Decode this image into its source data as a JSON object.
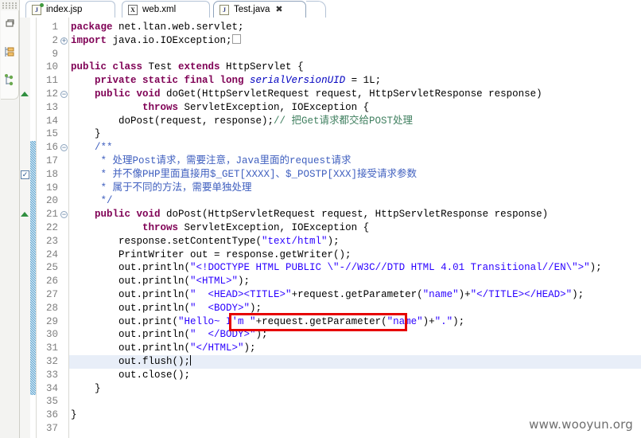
{
  "window": {
    "watermark": "www.wooyun.org"
  },
  "left_rail": {
    "drag_handle": "drag-handle",
    "icons": [
      {
        "name": "restore-view-icon",
        "glyph": "restore"
      },
      {
        "name": "outline-view-icon",
        "glyph": "outline"
      },
      {
        "name": "hierarchy-view-icon",
        "glyph": "hierarchy"
      }
    ]
  },
  "tabs": [
    {
      "label": "index.jsp",
      "icon": "jsp-file-icon",
      "icon_letter": "J",
      "active": false,
      "closable": false
    },
    {
      "label": "web.xml",
      "icon": "xml-file-icon",
      "icon_letter": "X",
      "active": false,
      "closable": false
    },
    {
      "label": "Test.java",
      "icon": "java-file-icon",
      "icon_letter": "J",
      "active": true,
      "closable": true,
      "close_glyph": "✖"
    }
  ],
  "editor": {
    "current_line": 32,
    "change_bar_from": 16,
    "change_bar_to": 34,
    "fold_markers": [
      {
        "line": 2,
        "type": "expand"
      },
      {
        "line": 12,
        "type": "collapse"
      },
      {
        "line": 16,
        "type": "collapse"
      },
      {
        "line": 21,
        "type": "collapse"
      }
    ],
    "overview_triangles": [
      12,
      21
    ],
    "task_checkbox_line": 18,
    "lines": [
      {
        "n": 1,
        "tokens": [
          {
            "t": "kw",
            "v": "package"
          },
          {
            "t": "cn",
            "v": " net.ltan.web.servlet;"
          }
        ]
      },
      {
        "n": 2,
        "tokens": [
          {
            "t": "kw",
            "v": "import"
          },
          {
            "t": "cn",
            "v": " java.io.IOException;"
          },
          {
            "t": "box",
            "v": " "
          }
        ]
      },
      {
        "n": 9,
        "tokens": []
      },
      {
        "n": 10,
        "tokens": [
          {
            "t": "kw",
            "v": "public class"
          },
          {
            "t": "cn",
            "v": " Test "
          },
          {
            "t": "kw",
            "v": "extends"
          },
          {
            "t": "cn",
            "v": " HttpServlet {"
          }
        ]
      },
      {
        "n": 11,
        "tokens": [
          {
            "t": "cn",
            "v": "    "
          },
          {
            "t": "kw",
            "v": "private static final long"
          },
          {
            "t": "fld",
            "v": " serialVersionUID"
          },
          {
            "t": "cn",
            "v": " = 1L;"
          }
        ]
      },
      {
        "n": 12,
        "tokens": [
          {
            "t": "cn",
            "v": "    "
          },
          {
            "t": "kw",
            "v": "public void"
          },
          {
            "t": "cn",
            "v": " doGet(HttpServletRequest request, HttpServletResponse response)"
          }
        ]
      },
      {
        "n": 13,
        "tokens": [
          {
            "t": "cn",
            "v": "            "
          },
          {
            "t": "kw",
            "v": "throws"
          },
          {
            "t": "cn",
            "v": " ServletException, IOException {"
          }
        ]
      },
      {
        "n": 14,
        "tokens": [
          {
            "t": "cn",
            "v": "        doPost(request, response);"
          },
          {
            "t": "cmt",
            "v": "// 把Get请求都交给POST处理"
          }
        ]
      },
      {
        "n": 15,
        "tokens": [
          {
            "t": "cn",
            "v": "    }"
          }
        ]
      },
      {
        "n": 16,
        "tokens": [
          {
            "t": "jdoc",
            "v": "    /**"
          }
        ]
      },
      {
        "n": 17,
        "tokens": [
          {
            "t": "jdoc",
            "v": "     * 处理Post请求，需要注意，Java里面的request请求"
          }
        ]
      },
      {
        "n": 18,
        "tokens": [
          {
            "t": "jdoc",
            "v": "     * 并不像PHP里面直接用$_GET[XXXX]、$_POSTP[XXX]接受请求参数"
          }
        ]
      },
      {
        "n": 19,
        "tokens": [
          {
            "t": "jdoc",
            "v": "     * 属于不同的方法，需要单独处理"
          }
        ]
      },
      {
        "n": 20,
        "tokens": [
          {
            "t": "jdoc",
            "v": "     */"
          }
        ]
      },
      {
        "n": 21,
        "tokens": [
          {
            "t": "cn",
            "v": "    "
          },
          {
            "t": "kw",
            "v": "public void"
          },
          {
            "t": "cn",
            "v": " doPost(HttpServletRequest request, HttpServletResponse response)"
          }
        ]
      },
      {
        "n": 22,
        "tokens": [
          {
            "t": "cn",
            "v": "            "
          },
          {
            "t": "kw",
            "v": "throws"
          },
          {
            "t": "cn",
            "v": " ServletException, IOException {"
          }
        ]
      },
      {
        "n": 23,
        "tokens": [
          {
            "t": "cn",
            "v": "        response.setContentType("
          },
          {
            "t": "str",
            "v": "\"text/html\""
          },
          {
            "t": "cn",
            "v": ");"
          }
        ]
      },
      {
        "n": 24,
        "tokens": [
          {
            "t": "cn",
            "v": "        PrintWriter out = response.getWriter();"
          }
        ]
      },
      {
        "n": 25,
        "tokens": [
          {
            "t": "cn",
            "v": "        out.println("
          },
          {
            "t": "str",
            "v": "\"<!DOCTYPE HTML PUBLIC \\\"-//W3C//DTD HTML 4.01 Transitional//EN\\\">\""
          },
          {
            "t": "cn",
            "v": ");"
          }
        ]
      },
      {
        "n": 26,
        "tokens": [
          {
            "t": "cn",
            "v": "        out.println("
          },
          {
            "t": "str",
            "v": "\"<HTML>\""
          },
          {
            "t": "cn",
            "v": ");"
          }
        ]
      },
      {
        "n": 27,
        "tokens": [
          {
            "t": "cn",
            "v": "        out.println("
          },
          {
            "t": "str",
            "v": "\"  <HEAD><TITLE>\""
          },
          {
            "t": "cn",
            "v": "+request.getParameter("
          },
          {
            "t": "str",
            "v": "\"name\""
          },
          {
            "t": "cn",
            "v": ")+"
          },
          {
            "t": "str",
            "v": "\"</TITLE></HEAD>\""
          },
          {
            "t": "cn",
            "v": ");"
          }
        ]
      },
      {
        "n": 28,
        "tokens": [
          {
            "t": "cn",
            "v": "        out.println("
          },
          {
            "t": "str",
            "v": "\"  <BODY>\""
          },
          {
            "t": "cn",
            "v": ");"
          }
        ]
      },
      {
        "n": 29,
        "tokens": [
          {
            "t": "cn",
            "v": "        out.print("
          },
          {
            "t": "str",
            "v": "\"Hello~ I'm \""
          },
          {
            "t": "cn",
            "v": "+request.getParameter("
          },
          {
            "t": "str",
            "v": "\"name\""
          },
          {
            "t": "cn",
            "v": ")+"
          },
          {
            "t": "str",
            "v": "\".\""
          },
          {
            "t": "cn",
            "v": ");"
          }
        ]
      },
      {
        "n": 30,
        "tokens": [
          {
            "t": "cn",
            "v": "        out.println("
          },
          {
            "t": "str",
            "v": "\"  </BODY>\""
          },
          {
            "t": "cn",
            "v": ");"
          }
        ]
      },
      {
        "n": 31,
        "tokens": [
          {
            "t": "cn",
            "v": "        out.println("
          },
          {
            "t": "str",
            "v": "\"</HTML>\""
          },
          {
            "t": "cn",
            "v": ");"
          }
        ]
      },
      {
        "n": 32,
        "tokens": [
          {
            "t": "cn",
            "v": "        out.flush();"
          },
          {
            "t": "caret",
            "v": ""
          }
        ]
      },
      {
        "n": 33,
        "tokens": [
          {
            "t": "cn",
            "v": "        out.close();"
          }
        ]
      },
      {
        "n": 34,
        "tokens": [
          {
            "t": "cn",
            "v": "    }"
          }
        ]
      },
      {
        "n": 35,
        "tokens": []
      },
      {
        "n": 36,
        "tokens": [
          {
            "t": "cn",
            "v": "}"
          }
        ]
      },
      {
        "n": 37,
        "tokens": []
      }
    ],
    "annotation": {
      "name": "red-highlight-box",
      "text": "request.getParameter(\"name\")",
      "color": "#e60000",
      "line": 29
    }
  }
}
